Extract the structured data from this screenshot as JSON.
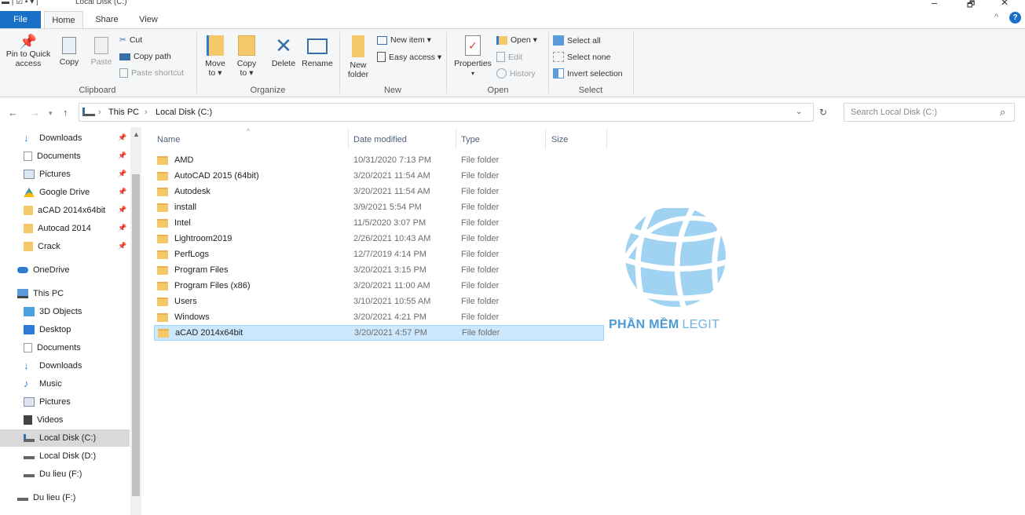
{
  "window": {
    "title": "Local Disk (C:)",
    "minimize": "–",
    "maximize": "🗗",
    "close": "✕"
  },
  "tabs": [
    "File",
    "Home",
    "Share",
    "View"
  ],
  "ribbon": {
    "clipboard": {
      "pin": "Pin to Quick access",
      "copy": "Copy",
      "paste": "Paste",
      "cut": "Cut",
      "copy_path": "Copy path",
      "paste_shortcut": "Paste shortcut",
      "label": "Clipboard"
    },
    "organize": {
      "move_to": "Move to ▾",
      "copy_to": "Copy to ▾",
      "delete": "Delete",
      "rename": "Rename",
      "label": "Organize"
    },
    "new": {
      "new_folder": "New folder",
      "new_item": "New item ▾",
      "easy_access": "Easy access ▾",
      "label": "New"
    },
    "open": {
      "properties": "Properties",
      "open": "Open ▾",
      "edit": "Edit",
      "history": "History",
      "label": "Open"
    },
    "select": {
      "select_all": "Select all",
      "select_none": "Select none",
      "invert": "Invert selection",
      "label": "Select"
    }
  },
  "address": {
    "path": [
      "This PC",
      "Local Disk (C:)"
    ],
    "search_placeholder": "Search Local Disk (C:)"
  },
  "nav": {
    "quick": [
      {
        "label": "Downloads",
        "icon": "download-icon"
      },
      {
        "label": "Documents",
        "icon": "document-icon"
      },
      {
        "label": "Pictures",
        "icon": "picture-icon"
      },
      {
        "label": "Google Drive",
        "icon": "google-drive-icon"
      },
      {
        "label": "aCAD 2014x64bit",
        "icon": "folder-icon"
      },
      {
        "label": "Autocad 2014",
        "icon": "folder-icon"
      },
      {
        "label": "Crack",
        "icon": "folder-icon"
      }
    ],
    "onedrive": "OneDrive",
    "thispc": "This PC",
    "pc_items": [
      {
        "label": "3D Objects",
        "icon": "3d-objects-icon"
      },
      {
        "label": "Desktop",
        "icon": "desktop-icon"
      },
      {
        "label": "Documents",
        "icon": "document-icon"
      },
      {
        "label": "Downloads",
        "icon": "download-icon"
      },
      {
        "label": "Music",
        "icon": "music-icon"
      },
      {
        "label": "Pictures",
        "icon": "picture-icon"
      },
      {
        "label": "Videos",
        "icon": "video-icon"
      },
      {
        "label": "Local Disk (C:)",
        "icon": "drive-icon"
      },
      {
        "label": "Local Disk (D:)",
        "icon": "drive-icon"
      },
      {
        "label": "Du lieu (F:)",
        "icon": "drive-icon"
      }
    ],
    "extra": "Du lieu (F:)"
  },
  "columns": {
    "name": "Name",
    "date": "Date modified",
    "type": "Type",
    "size": "Size"
  },
  "files": [
    {
      "name": "AMD",
      "date": "10/31/2020 7:13 PM",
      "type": "File folder"
    },
    {
      "name": "AutoCAD 2015 (64bit)",
      "date": "3/20/2021 11:54 AM",
      "type": "File folder"
    },
    {
      "name": "Autodesk",
      "date": "3/20/2021 11:54 AM",
      "type": "File folder"
    },
    {
      "name": "install",
      "date": "3/9/2021 5:54 PM",
      "type": "File folder"
    },
    {
      "name": "Intel",
      "date": "11/5/2020 3:07 PM",
      "type": "File folder"
    },
    {
      "name": "Lightroom2019",
      "date": "2/26/2021 10:43 AM",
      "type": "File folder"
    },
    {
      "name": "PerfLogs",
      "date": "12/7/2019 4:14 PM",
      "type": "File folder"
    },
    {
      "name": "Program Files",
      "date": "3/20/2021 3:15 PM",
      "type": "File folder"
    },
    {
      "name": "Program Files (x86)",
      "date": "3/20/2021 11:00 AM",
      "type": "File folder"
    },
    {
      "name": "Users",
      "date": "3/10/2021 10:55 AM",
      "type": "File folder"
    },
    {
      "name": "Windows",
      "date": "3/20/2021 4:21 PM",
      "type": "File folder"
    },
    {
      "name": "aCAD 2014x64bit",
      "date": "3/20/2021 4:57 PM",
      "type": "File folder"
    }
  ],
  "selected_file": "aCAD 2014x64bit",
  "watermark": {
    "part1": "PHẦN MỀM",
    "part2": "LEGIT"
  },
  "colors": {
    "accent": "#1a6fc7",
    "selection": "#cce8ff",
    "folder": "#f5c86a",
    "watermark_blue": "#5aa8dc"
  }
}
